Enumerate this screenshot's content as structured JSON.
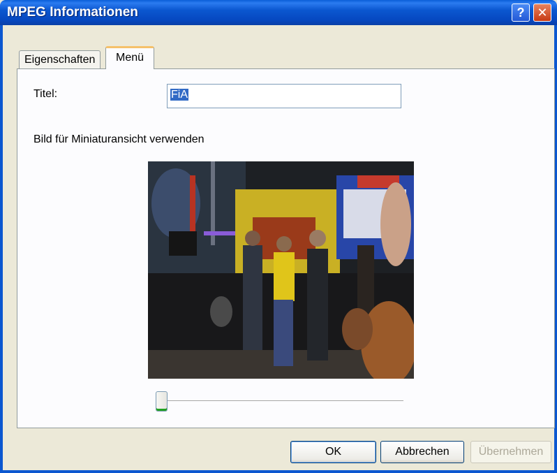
{
  "window": {
    "title": "MPEG Informationen",
    "help_label": "?",
    "close_label": "✕"
  },
  "tabs": [
    {
      "label": "Eigenschaften",
      "active": false
    },
    {
      "label": "Menü",
      "active": true
    }
  ],
  "form": {
    "title_label": "Titel:",
    "title_value": "FiA",
    "thumbnail_label": "Bild für Miniaturansicht verwenden"
  },
  "slider": {
    "value_fraction": 0.0
  },
  "buttons": {
    "ok": "OK",
    "cancel": "Abbrechen",
    "apply": "Übernehmen"
  },
  "colors": {
    "titlebar": "#0b57d0",
    "dialog_bg": "#ece9d8",
    "panel_bg": "#fcfcfe",
    "selection": "#316ac5"
  }
}
